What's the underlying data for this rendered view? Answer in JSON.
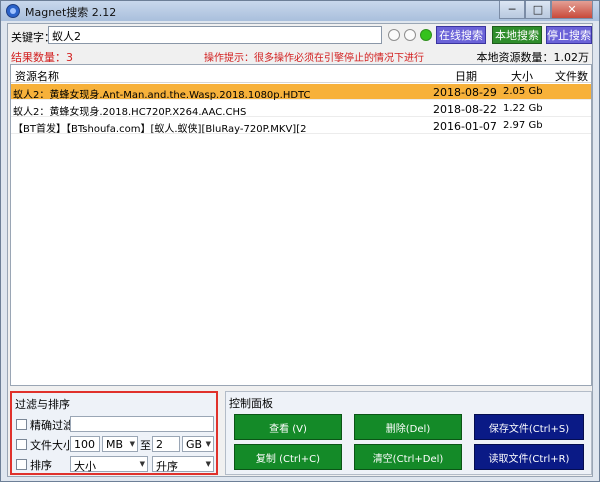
{
  "window": {
    "title": "Magnet搜索 2.12",
    "controls": {
      "minimize": "─",
      "maximize": "□",
      "close": "✕"
    }
  },
  "search": {
    "label": "关键字：",
    "value": "蚁人2",
    "radio_selected_index": 2,
    "buttons": {
      "online": "在线搜索",
      "local": "本地搜索",
      "stop": "停止搜索"
    }
  },
  "status": {
    "result_count": "结果数量：3",
    "hint": "操作提示：很多操作必须在引擎停止的情况下进行",
    "local_count": "本地资源数量：1.02万"
  },
  "table": {
    "columns": {
      "name": "资源名称",
      "date": "日期",
      "size": "大小",
      "files": "文件数"
    },
    "rows": [
      {
        "name": "蚁人2：黄蜂女现身.Ant-Man.and.the.Wasp.2018.1080p.HDTC",
        "date": "2018-08-29",
        "size": "2.05 Gb",
        "files": ""
      },
      {
        "name": "蚁人2：黄蜂女现身.2018.HC720P.X264.AAC.CHS",
        "date": "2018-08-22",
        "size": "1.22 Gb",
        "files": ""
      },
      {
        "name": "【BT首发】【BTshoufa.com】[蚁人.蚁侠][BluRay-720P.MKV][2",
        "date": "2016-01-07",
        "size": "2.97 Gb",
        "files": ""
      }
    ],
    "selected_row": 0
  },
  "filter": {
    "title": "过滤与排序",
    "exact_filter": {
      "label": "精确过滤",
      "value": ""
    },
    "file_size": {
      "label": "文件大小",
      "min": "100",
      "min_unit": "MB",
      "to": "至",
      "max": "2",
      "max_unit": "GB"
    },
    "sort": {
      "label": "排序",
      "by": "大小",
      "order": "升序"
    }
  },
  "control": {
    "title": "控制面板",
    "buttons": {
      "view": "查看 (V)",
      "delete": "删除(Del)",
      "save_file": "保存文件(Ctrl+S)",
      "copy": "复制 (Ctrl+C)",
      "clear": "清空(Ctrl+Del)",
      "read_file": "读取文件(Ctrl+R)"
    }
  },
  "colors": {
    "selected_row": "#f7b13a",
    "green_button": "#148a28",
    "navy_button": "#0a1a86",
    "purple_button": "#6b63d8",
    "alert_text": "#d22020"
  }
}
